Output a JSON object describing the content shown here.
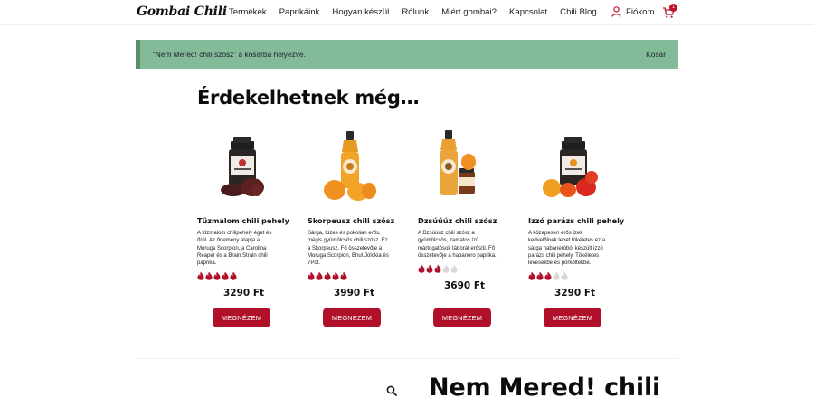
{
  "header": {
    "logo": "Gombai Chili",
    "nav": [
      "Termékek",
      "Paprikáink",
      "Hogyan készül",
      "Rólunk",
      "Miért gombai?",
      "Kapcsolat",
      "Chili Blog"
    ],
    "account_label": "Fiókom",
    "cart_count": "1",
    "icons": {
      "account": "user-icon",
      "cart": "cart-icon"
    }
  },
  "notice": {
    "text": "“Nem Mered! chili szósz” a kosárba helyezve.",
    "link": "Kosár",
    "color": "#83bb98"
  },
  "section": {
    "title": "Érdekelhetnek még…"
  },
  "products": [
    {
      "name": "Tűzmalom chili pehely",
      "desc": "A tűzmalom chilipehely éget és őröl. Az őrlemény alapja a Moruga Scorpion, a Carolina Reaper és a Brain Strain chili paprika.",
      "rating": 5,
      "price": "3290 Ft",
      "button": "MEGNÉZEM"
    },
    {
      "name": "Skorpeusz chili szósz",
      "desc": "Sárga, tüzes és pokolian erős, mégis gyümölcsös chili szósz. Ez a Skorpeusz. Fő összetevője a Moruga Scorpion, Bhut Jolokia és 7Pot.",
      "rating": 5,
      "price": "3990 Ft",
      "button": "MEGNÉZEM"
    },
    {
      "name": "Dzsúúúz chili szósz",
      "desc": "A Dzsúúúz chili szósz a gyümölcsös, zamatos ízű mártogatósok táborát erősíti. Fő összetevője a habanero paprika.",
      "rating": 3,
      "price": "3690 Ft",
      "button": "MEGNÉZEM"
    },
    {
      "name": "Izzó parázs chili pehely",
      "desc": "A közepesen erős ízek kedvelőinek lehet tökéletes ez a sárga habaneróból készült izzó parázs chili pehely. Tökéletes levesekbe és pörköltekbe.",
      "rating": 3,
      "price": "3290 Ft",
      "button": "MEGNÉZEM"
    }
  ],
  "rating_max": 5,
  "colors": {
    "accent": "#b0102a",
    "flame_on": "#b0102a",
    "flame_off": "#d8d8d8"
  },
  "bottom": {
    "title": "Nem Mered! chili",
    "search_icon": "search-icon"
  }
}
